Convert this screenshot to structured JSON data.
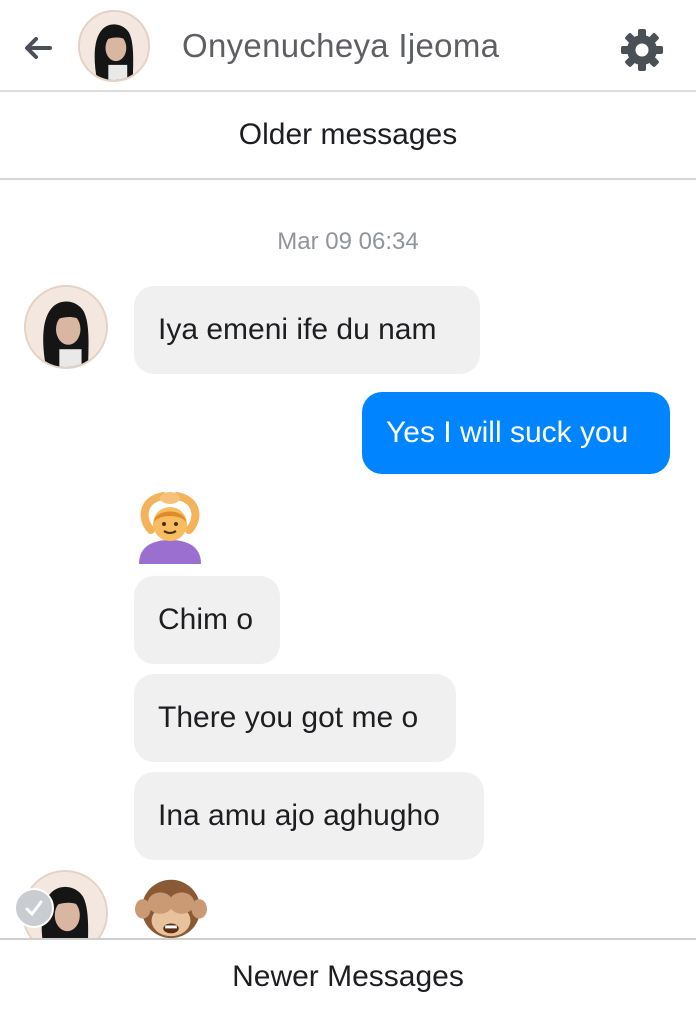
{
  "header": {
    "back_icon": "arrow-left-icon",
    "contact_name": "Onyenucheya Ijeoma",
    "settings_icon": "gear-icon"
  },
  "older_messages_label": "Older messages",
  "conversation": {
    "timestamp": "Mar 09 06:34",
    "messages": [
      {
        "direction": "incoming",
        "text": "Iya emeni ife du nam"
      },
      {
        "direction": "outgoing",
        "text": "Yes I will suck you"
      },
      {
        "direction": "incoming",
        "type": "emoji",
        "emoji": "person-gesturing-ok-emoji"
      },
      {
        "direction": "incoming",
        "text": "Chim o"
      },
      {
        "direction": "incoming",
        "text": "There you got me o"
      },
      {
        "direction": "incoming",
        "text": "Ina amu ajo aghugho"
      },
      {
        "direction": "incoming",
        "type": "emoji",
        "emoji": "see-no-evil-monkey-emoji"
      }
    ]
  },
  "newer_messages_label": "Newer Messages",
  "colors": {
    "outgoing_bubble": "#0084ff",
    "incoming_bubble": "#f1f0f0",
    "timestamp_text": "#90949c",
    "name_text": "#5d5f63"
  }
}
